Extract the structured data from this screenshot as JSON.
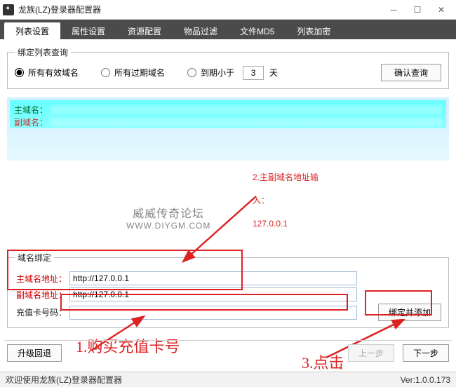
{
  "window": {
    "title": "龙族(LZ)登录器配置器"
  },
  "tabs": {
    "items": [
      "列表设置",
      "属性设置",
      "资源配置",
      "物品过滤",
      "文件MD5",
      "列表加密"
    ],
    "active_index": 0
  },
  "query_group": {
    "legend": "绑定列表查询",
    "radio_all_valid": "所有有效域名",
    "radio_all_expired": "所有过期域名",
    "radio_expiring": "到期小于",
    "days_value": "3",
    "days_suffix": "天",
    "selected": "all_valid",
    "confirm_btn": "确认查询"
  },
  "result": {
    "main_domain_label": "主域名：",
    "sub_domain_label": "副域名："
  },
  "watermark": {
    "line1": "威威传奇论坛",
    "line2": "WWW.DIYGM.COM"
  },
  "bind_group": {
    "legend": "域名绑定",
    "main_label": "主域名地址：",
    "sub_label": "副域名地址：",
    "card_label": "充值卡号码：",
    "main_value": "http://127.0.0.1",
    "sub_value": "http://127.0.0.1",
    "card_value": "",
    "bind_btn": "绑定并添加"
  },
  "bottom": {
    "rollback_btn": "升级回退",
    "prev_btn": "上一步",
    "next_btn": "下一步"
  },
  "status": {
    "welcome": "欢迎使用龙族(LZ)登录器配置器",
    "version_label": "Ver:",
    "version": "1.0.0.173"
  },
  "annotations": {
    "a2_line1": "2.主副域名地址输",
    "a2_line2": "入：",
    "a2_line3": "127.0.0.1",
    "a1": "1.购买充值卡号",
    "a3": "3.点击"
  }
}
